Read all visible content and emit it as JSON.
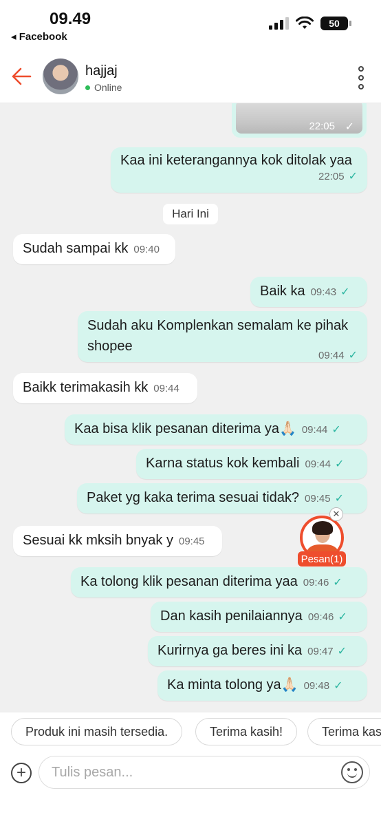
{
  "status_bar": {
    "time": "09.49",
    "back_app": "◂ Facebook",
    "battery": "50"
  },
  "header": {
    "contact_name": "hajjaj",
    "status": "Online"
  },
  "chat": {
    "date_divider": "Hari Ini",
    "messages": [
      {
        "dir": "out",
        "text": "",
        "time": "22:05",
        "read": true,
        "kind": "image"
      },
      {
        "dir": "out",
        "text": "Kaa ini keterangannya kok ditolak yaa",
        "time": "22:05",
        "read": true
      },
      {
        "dir": "in",
        "text": "Sudah sampai kk",
        "time": "09:40"
      },
      {
        "dir": "out",
        "text": "Baik ka",
        "time": "09:43",
        "read": true
      },
      {
        "dir": "out",
        "text": "Sudah aku Komplenkan semalam ke pihak shopee",
        "time": "09:44",
        "read": true
      },
      {
        "dir": "in",
        "text": "Baikk terimakasih kk",
        "time": "09:44"
      },
      {
        "dir": "out",
        "text": "Kaa bisa klik pesanan diterima ya🙏🏻",
        "time": "09:44",
        "read": true
      },
      {
        "dir": "out",
        "text": "Karna status kok kembali",
        "time": "09:44",
        "read": true
      },
      {
        "dir": "out",
        "text": "Paket yg kaka terima sesuai tidak?",
        "time": "09:45",
        "read": true
      },
      {
        "dir": "in",
        "text": "Sesuai kk mksih bnyak y",
        "time": "09:45"
      },
      {
        "dir": "out",
        "text": "Ka tolong klik pesanan diterima yaa",
        "time": "09:46",
        "read": true
      },
      {
        "dir": "out",
        "text": "Dan kasih penilaiannya",
        "time": "09:46",
        "read": true
      },
      {
        "dir": "out",
        "text": "Kurirnya ga beres ini ka",
        "time": "09:47",
        "read": true
      },
      {
        "dir": "out",
        "text": "Ka minta tolong ya🙏🏻",
        "time": "09:48",
        "read": true
      }
    ]
  },
  "promo": {
    "label": "Pesan(1)",
    "close": "✕"
  },
  "quick_replies": [
    "Produk ini masih tersedia.",
    "Terima kasih!",
    "Terima kas"
  ],
  "input": {
    "placeholder": "Tulis pesan..."
  },
  "colors": {
    "accent": "#ee4d2d",
    "outgoing_bubble": "#d6f5ee",
    "read_check": "#2bb5a0",
    "online": "#2ebd59"
  },
  "icons": {
    "back": "back-arrow-icon",
    "more": "more-vertical-icon",
    "attach": "plus-circle-icon",
    "emoji": "emoji-icon",
    "read": "check-icon"
  }
}
